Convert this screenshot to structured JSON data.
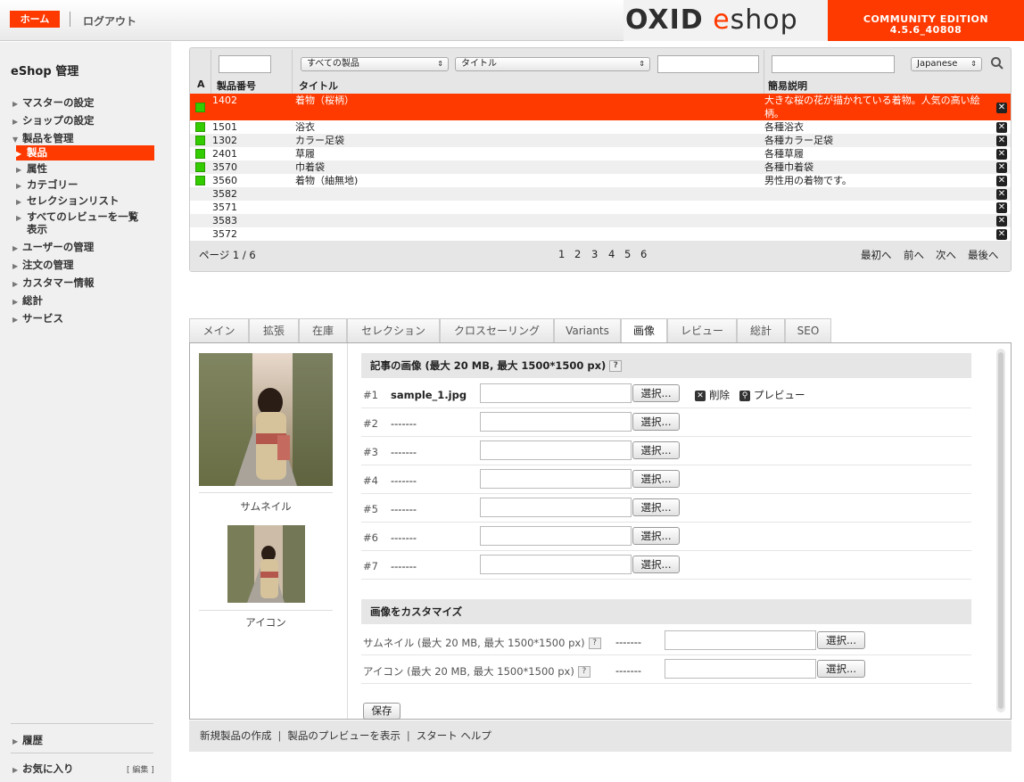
{
  "header": {
    "home": "ホーム",
    "logout": "ログアウト",
    "logo_oxid": "OXID",
    "logo_e": "e",
    "logo_shop": "shop",
    "edition_line1": "COMMUNITY EDITION",
    "edition_line2": "4.5.6_40808"
  },
  "sidebar": {
    "title": "eShop 管理",
    "items": [
      "マスターの設定",
      "ショップの設定",
      "製品を管理"
    ],
    "sub": [
      "製品",
      "属性",
      "カテゴリー",
      "セレクションリスト",
      "すべてのレビューを一覧",
      "表示"
    ],
    "items2": [
      "ユーザーの管理",
      "注文の管理",
      "カスタマー情報",
      "総計",
      "サービス"
    ],
    "history": "履歴",
    "favorites": "お気に入り",
    "edit": "[ 編集 ]"
  },
  "list": {
    "headers": {
      "a": "A",
      "id": "製品番号",
      "title": "タイトル",
      "desc": "簡易説明"
    },
    "filter": {
      "category": "すべての製品",
      "field": "タイトル",
      "lang": "Japanese"
    },
    "rows": [
      {
        "id": "1402",
        "title": "着物（桜柄）",
        "desc": "大きな桜の花が描かれている着物。人気の高い絵柄。",
        "active": true
      },
      {
        "id": "1501",
        "title": "浴衣",
        "desc": "各種浴衣",
        "active": true
      },
      {
        "id": "1302",
        "title": "カラー足袋",
        "desc": "各種カラー足袋",
        "active": true
      },
      {
        "id": "2401",
        "title": "草履",
        "desc": "各種草履",
        "active": true
      },
      {
        "id": "3570",
        "title": "巾着袋",
        "desc": "各種巾着袋",
        "active": true
      },
      {
        "id": "3560",
        "title": "着物（紬無地)",
        "desc": "男性用の着物です。",
        "active": true
      },
      {
        "id": "3582",
        "title": "",
        "desc": "",
        "active": false
      },
      {
        "id": "3571",
        "title": "",
        "desc": "",
        "active": false
      },
      {
        "id": "3583",
        "title": "",
        "desc": "",
        "active": false
      },
      {
        "id": "3572",
        "title": "",
        "desc": "",
        "active": false
      }
    ],
    "page_info": "ページ 1 / 6",
    "pages": [
      "1",
      "2",
      "3",
      "4",
      "5",
      "6"
    ],
    "nav": {
      "first": "最初へ",
      "prev": "前へ",
      "next": "次へ",
      "last": "最後へ"
    }
  },
  "tabs": [
    "メイン",
    "拡張",
    "在庫",
    "セレクション",
    "クロスセーリング",
    "Variants",
    "画像",
    "レビュー",
    "総計",
    "SEO"
  ],
  "active_tab": "画像",
  "images": {
    "thumb_label": "サムネイル",
    "icon_label": "アイコン",
    "section_title": "記事の画像 (最大 20 MB, 最大 1500*1500 px)",
    "slots": [
      {
        "num": "#1",
        "file": "sample_1.jpg"
      },
      {
        "num": "#2",
        "file": "-------"
      },
      {
        "num": "#3",
        "file": "-------"
      },
      {
        "num": "#4",
        "file": "-------"
      },
      {
        "num": "#5",
        "file": "-------"
      },
      {
        "num": "#6",
        "file": "-------"
      },
      {
        "num": "#7",
        "file": "-------"
      }
    ],
    "select_btn": "選択...",
    "delete": "削除",
    "preview": "プレビュー",
    "custom_title": "画像をカスタマイズ",
    "custom": [
      {
        "label": "サムネイル (最大 20 MB, 最大 1500*1500 px)",
        "file": "-------"
      },
      {
        "label": "アイコン (最大 20 MB, 最大 1500*1500 px)",
        "file": "-------"
      }
    ],
    "save": "保存",
    "help": "?"
  },
  "footer": {
    "create": "新規製品の作成",
    "preview": "製品のプレビューを表示",
    "help": "スタート ヘルプ",
    "sep": "|"
  },
  "colors": {
    "accent": "#ff3a00",
    "active": "#33cc00"
  }
}
